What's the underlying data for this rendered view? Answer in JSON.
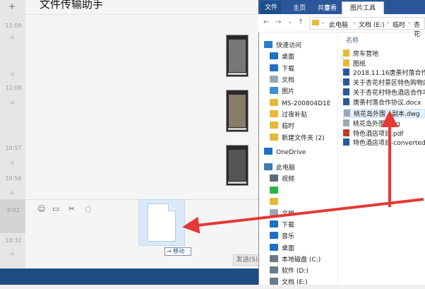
{
  "chat": {
    "title": "文件传输助手",
    "times": [
      "11:08",
      "11:09",
      "10:57",
      "10:56",
      "9:02",
      "10:32"
    ],
    "plus": "+",
    "send_label": "发送(S)"
  },
  "drag": {
    "tooltip": "→ 移动"
  },
  "explorer": {
    "tabs": {
      "file": "文件",
      "home": "主页",
      "share": "共享",
      "view": "查看",
      "picture_tools": "图片工具"
    },
    "breadcrumb": [
      "此电脑",
      "文档 (E:)",
      "临时",
      "杏花"
    ],
    "column_name": "名称",
    "nav_items": [
      {
        "label": "快速访问",
        "icon": "star-icon",
        "color": "#2b7cd3"
      },
      {
        "label": "桌面",
        "icon": "desktop-icon",
        "color": "#1e6fc7"
      },
      {
        "label": "下载",
        "icon": "download-icon",
        "color": "#1e6fc7"
      },
      {
        "label": "文档",
        "icon": "document-icon",
        "color": "#9aa8b8"
      },
      {
        "label": "图片",
        "icon": "pictures-icon",
        "color": "#3a8fd6"
      },
      {
        "label": "MS-200804D1E",
        "icon": "folder-icon",
        "color": "#e8b838"
      },
      {
        "label": "过夜补贴",
        "icon": "folder-icon",
        "color": "#e8b838"
      },
      {
        "label": "临时",
        "icon": "folder-icon",
        "color": "#e8b838"
      },
      {
        "label": "新建文件夹 (2)",
        "icon": "folder-icon",
        "color": "#e8b838"
      },
      {
        "label": "OneDrive",
        "icon": "cloud-icon",
        "color": "#1e6fc7"
      },
      {
        "label": "此电脑",
        "icon": "computer-icon",
        "color": "#3a7ab8"
      },
      {
        "label": "视频",
        "icon": "video-icon",
        "color": "#5a6a7a"
      },
      {
        "label": "",
        "icon": "wechat-icon",
        "color": "#2ab54a"
      },
      {
        "label": "",
        "icon": "picture-icon",
        "color": "#e8b838"
      },
      {
        "label": "文档",
        "icon": "document-icon",
        "color": "#9aa8b8"
      },
      {
        "label": "下载",
        "icon": "download-icon",
        "color": "#1e6fc7"
      },
      {
        "label": "音乐",
        "icon": "music-icon",
        "color": "#1e6fc7"
      },
      {
        "label": "桌面",
        "icon": "desktop-icon",
        "color": "#1e6fc7"
      },
      {
        "label": "本地磁盘 (C:)",
        "icon": "drive-icon",
        "color": "#6a7a8a"
      },
      {
        "label": "软件 (D:)",
        "icon": "drive-icon",
        "color": "#6a7a8a"
      },
      {
        "label": "文档 (E:)",
        "icon": "drive-icon",
        "color": "#6a7a8a"
      }
    ],
    "files": [
      {
        "name": "房车营地",
        "icon": "folder-icon",
        "color": "#e8b838"
      },
      {
        "name": "图纸",
        "icon": "folder-icon",
        "color": "#e8b838"
      },
      {
        "name": "2018.11.16唐荼村落合作协议",
        "icon": "word-icon",
        "color": "#2b579a"
      },
      {
        "name": "关于杏花村景区特色购物店",
        "icon": "word-icon",
        "color": "#2b579a"
      },
      {
        "name": "关于杏花村特色酒店合作项目",
        "icon": "word-icon",
        "color": "#2b579a"
      },
      {
        "name": "唐荼村落合作协议.docx",
        "icon": "word-icon",
        "color": "#2b579a"
      },
      {
        "name": "桃花岛外围 - 副本.dwg",
        "icon": "dwg-icon",
        "color": "#9aa8b8",
        "selected": true
      },
      {
        "name": "桃花岛外围.dwg",
        "icon": "dwg-icon",
        "color": "#9aa8b8"
      },
      {
        "name": "特色酒店项目.pdf",
        "icon": "pdf-icon",
        "color": "#c0392b"
      },
      {
        "name": "特色酒店项目-converted.docx",
        "icon": "word-icon",
        "color": "#2b579a"
      }
    ]
  },
  "colors": {
    "ribbon": "#2b579a",
    "arrow": "#e53935",
    "selection": "#e5f1fb"
  }
}
